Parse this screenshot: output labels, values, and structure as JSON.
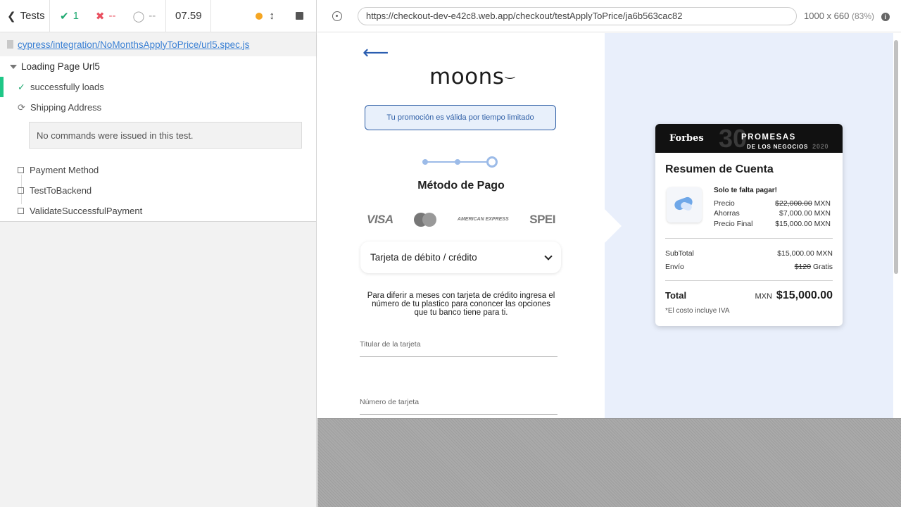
{
  "reporter": {
    "header": {
      "tests_label": "Tests",
      "passed": "1",
      "failed": "--",
      "pending": "--",
      "duration": "07.59"
    },
    "spec_path": "cypress/integration/NoMonthsApplyToPrice/url5.spec.js",
    "suite": {
      "title": "Loading Page Url5",
      "tests": [
        {
          "title": "successfully loads",
          "state": "passed"
        },
        {
          "title": "Shipping Address",
          "state": "running",
          "message": "No commands were issued in this test."
        },
        {
          "title": "Payment Method",
          "state": "pending"
        },
        {
          "title": "TestToBackend",
          "state": "pending"
        },
        {
          "title": "ValidateSuccessfulPayment",
          "state": "pending"
        }
      ]
    }
  },
  "aut": {
    "url": "https://checkout-dev-e42c8.web.app/checkout/testApplyToPrice/ja6b563cac82",
    "viewport": "1000 x 660",
    "scale": "(83%)"
  },
  "checkout": {
    "brand": "moons",
    "promo": "Tu promoción es válida por tiempo limitado",
    "step_title": "Método de Pago",
    "card_logos": [
      "VISA",
      "mastercard",
      "AMERICAN EXPRESS",
      "SPEI"
    ],
    "payment_select": "Tarjeta de débito / crédito",
    "msi_text": "Para diferir a meses con tarjeta de crédito ingresa el número de tu plastico para cononcer las opciones que tu banco tiene para ti.",
    "fields": {
      "holder": "Titular de la tarjeta",
      "number": "Número de tarjeta"
    }
  },
  "summary": {
    "banner_brand": "Forbes",
    "banner_number": "30",
    "banner_line1": "PROMESAS",
    "banner_line2": "DE LOS NEGOCIOS",
    "banner_year": "2020",
    "title": "Resumen de Cuenta",
    "subtitle": "Solo te falta pagar!",
    "precio_label": "Precio",
    "precio_value": "$22,000.00",
    "precio_cur": "MXN",
    "ahorras_label": "Ahorras",
    "ahorras_value": "$7,000.00 MXN",
    "precio_final_label": "Precio Final",
    "precio_final_value": "$15,000.00 MXN",
    "subtotal_label": "SubTotal",
    "subtotal_value": "$15,000.00 MXN",
    "envio_label": "Envío",
    "envio_old": "$120",
    "envio_value": "Gratis",
    "total_label": "Total",
    "total_currency": "MXN",
    "total_value": "$15,000.00",
    "iva_note": "*El costo incluye IVA"
  },
  "colors": {
    "pass": "#1fa971",
    "fail": "#e94f5f",
    "accent": "#2f5fa6",
    "summary_bg": "#e9effb"
  }
}
